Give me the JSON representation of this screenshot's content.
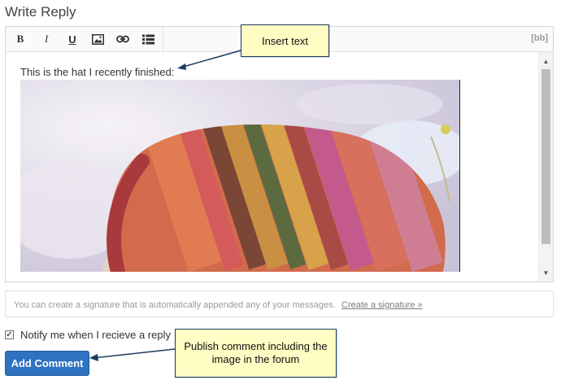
{
  "page": {
    "title": "Write Reply"
  },
  "toolbar": {
    "bold_label": "B",
    "italic_label": "I",
    "underline_label": "U",
    "image_icon": "image-icon",
    "link_icon": "link-icon",
    "list_icon": "list-icon",
    "mode_toggle": "[bb]"
  },
  "editor": {
    "text": "This is the hat I recently finished:",
    "image_subject": "knitted-hat-photo"
  },
  "signature": {
    "message": "You can create a signature that is automatically appended any of your messages.",
    "link": "Create a signature »"
  },
  "notify": {
    "label": "Notify me when I recieve a reply",
    "checked": true
  },
  "submit": {
    "label": "Add Comment"
  },
  "callouts": {
    "insert_text": "Insert text",
    "publish": "Publish comment including the image in the forum"
  },
  "colors": {
    "primary_button": "#2f72c0",
    "callout_bg": "#fffdc4",
    "callout_border": "#1e3b60"
  }
}
